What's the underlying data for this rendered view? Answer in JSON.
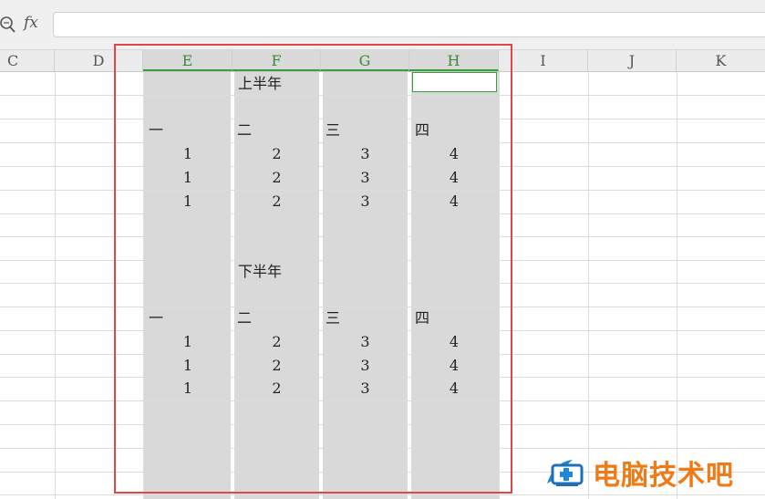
{
  "formula_bar": {
    "fx_label": "fx",
    "value": ""
  },
  "columns": [
    "C",
    "D",
    "E",
    "F",
    "G",
    "H",
    "I",
    "J",
    "K"
  ],
  "selected_columns": [
    "E",
    "F",
    "G",
    "H"
  ],
  "sections": [
    {
      "title": "上半年",
      "headers": [
        "一",
        "二",
        "三",
        "四"
      ],
      "rows": [
        [
          "1",
          "2",
          "3",
          "4"
        ],
        [
          "1",
          "2",
          "3",
          "4"
        ],
        [
          "1",
          "2",
          "3",
          "4"
        ]
      ]
    },
    {
      "title": "下半年",
      "headers": [
        "一",
        "二",
        "三",
        "四"
      ],
      "rows": [
        [
          "1",
          "2",
          "3",
          "4"
        ],
        [
          "1",
          "2",
          "3",
          "4"
        ],
        [
          "1",
          "2",
          "3",
          "4"
        ]
      ]
    }
  ],
  "watermark": {
    "text": "电脑技术吧"
  },
  "colors": {
    "selection_bg": "#d9d9d9",
    "active_border": "#3d9c3d",
    "highlight_border": "#e04848",
    "watermark": "#ef7a16"
  }
}
